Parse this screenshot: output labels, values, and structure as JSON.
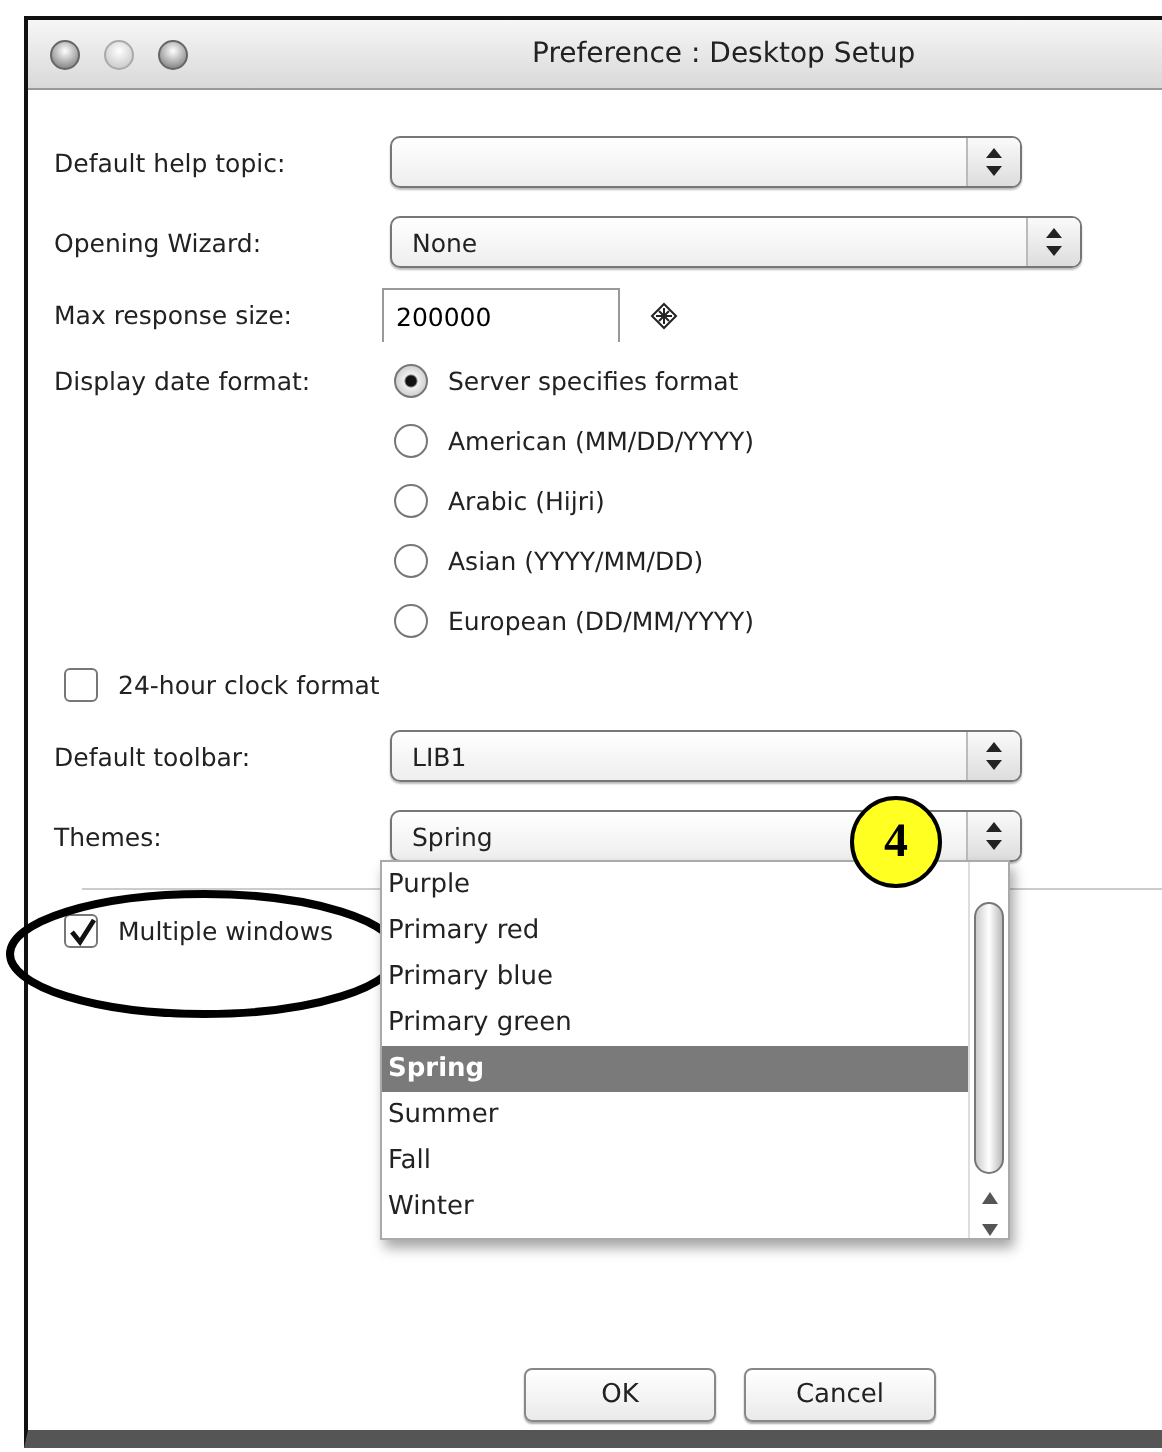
{
  "window": {
    "title": "Preference : Desktop Setup"
  },
  "fields": [
    {
      "kind": "select",
      "label": "Default help topic:"
    },
    {
      "kind": "select",
      "label": "Opening Wizard:",
      "value": "None"
    },
    {
      "kind": "text",
      "label": "Max response size:",
      "value": "200000"
    },
    {
      "kind": "radio",
      "label": "Display date format:",
      "options": [
        {
          "label": "Server specifies format",
          "selected": true
        },
        {
          "label": "American (MM/DD/YYYY)",
          "selected": false
        },
        {
          "label": "Arabic (Hijri)",
          "selected": false
        },
        {
          "label": "Asian (YYYY/MM/DD)",
          "selected": false
        },
        {
          "label": "European (DD/MM/YYYY)",
          "selected": false
        }
      ]
    },
    {
      "kind": "checkbox",
      "label": "24-hour clock format",
      "checked": false
    },
    {
      "kind": "select",
      "label": "Default toolbar:",
      "value": "LIB1"
    },
    {
      "kind": "select",
      "label": "Themes:",
      "value": "Spring",
      "expanded": true,
      "options": [
        {
          "label": "Purple",
          "selected": false
        },
        {
          "label": "Primary red",
          "selected": false
        },
        {
          "label": "Primary blue",
          "selected": false
        },
        {
          "label": "Primary green",
          "selected": false
        },
        {
          "label": "Spring",
          "selected": true
        },
        {
          "label": "Summer",
          "selected": false
        },
        {
          "label": "Fall",
          "selected": false
        },
        {
          "label": "Winter",
          "selected": false
        }
      ]
    },
    {
      "kind": "checkbox",
      "label": "Multiple windows",
      "checked": true
    }
  ],
  "buttons": [
    {
      "label": "OK"
    },
    {
      "label": "Cancel"
    }
  ],
  "annotations": {
    "callout": "4",
    "ellipse": true
  }
}
